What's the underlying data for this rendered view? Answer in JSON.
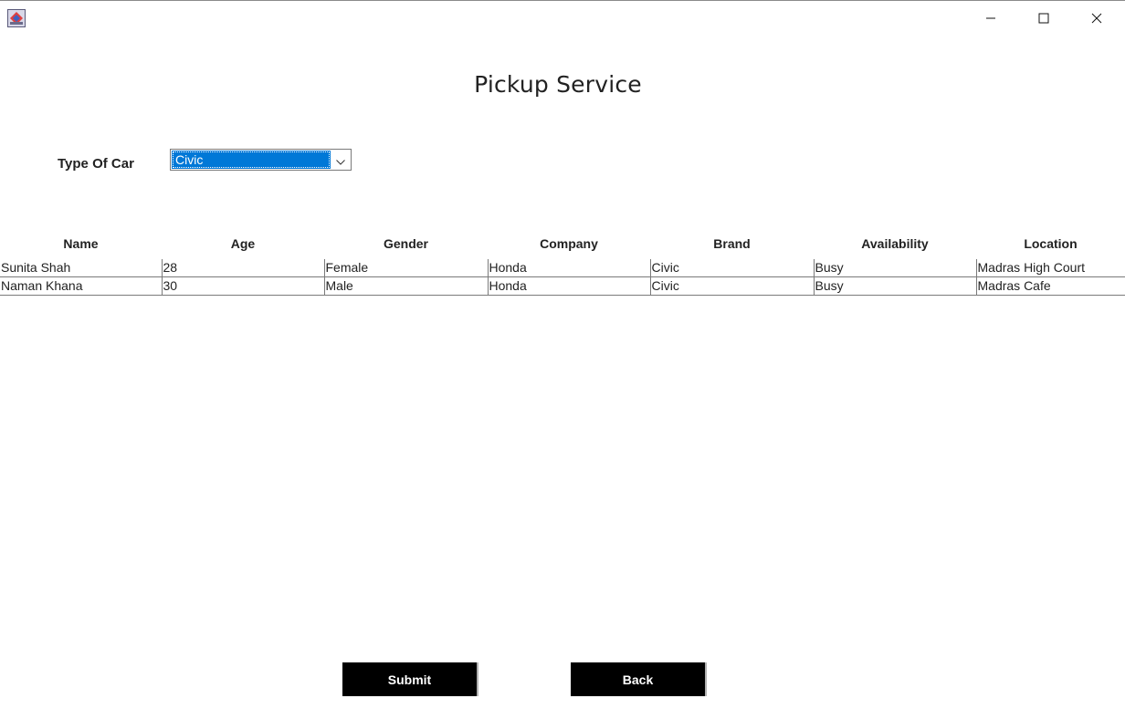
{
  "window": {
    "controls": {
      "minimize_icon": "minimize-icon",
      "maximize_icon": "maximize-icon",
      "close_icon": "close-icon"
    }
  },
  "page": {
    "title": "Pickup Service"
  },
  "form": {
    "car_type_label": "Type Of Car",
    "car_type_value": "Civic"
  },
  "table": {
    "headers": [
      "Name",
      "Age",
      "Gender",
      "Company",
      "Brand",
      "Availability",
      "Location"
    ],
    "rows": [
      [
        "Sunita Shah",
        "28",
        "Female",
        "Honda",
        "Civic",
        "Busy",
        "Madras High Court"
      ],
      [
        "Naman Khana",
        "30",
        "Male",
        "Honda",
        "Civic",
        "Busy",
        "Madras Cafe"
      ]
    ]
  },
  "buttons": {
    "submit": "Submit",
    "back": "Back"
  },
  "colors": {
    "selection": "#0078d7",
    "button_bg": "#000000",
    "button_text": "#ffffff"
  }
}
